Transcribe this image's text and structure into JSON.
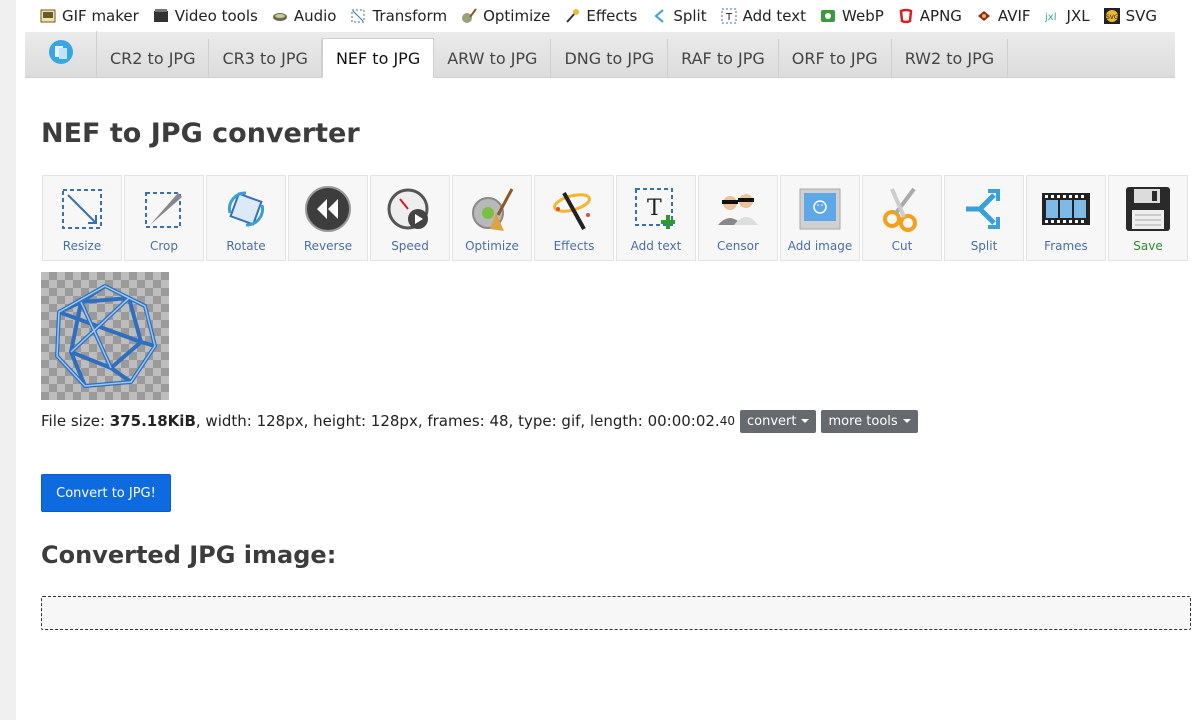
{
  "topnav": {
    "items": [
      {
        "label": "GIF maker",
        "icon": "gif-maker-icon"
      },
      {
        "label": "Video tools",
        "icon": "video-tools-icon"
      },
      {
        "label": "Audio",
        "icon": "audio-icon"
      },
      {
        "label": "Transform",
        "icon": "transform-icon"
      },
      {
        "label": "Optimize",
        "icon": "optimize-icon"
      },
      {
        "label": "Effects",
        "icon": "effects-icon"
      },
      {
        "label": "Split",
        "icon": "split-icon"
      },
      {
        "label": "Add text",
        "icon": "add-text-icon"
      },
      {
        "label": "WebP",
        "icon": "webp-icon"
      },
      {
        "label": "APNG",
        "icon": "apng-icon"
      },
      {
        "label": "AVIF",
        "icon": "avif-icon"
      },
      {
        "label": "JXL",
        "icon": "jxl-icon"
      },
      {
        "label": "SVG",
        "icon": "svg-icon"
      }
    ]
  },
  "tabs": {
    "home_icon": "home-icon",
    "items": [
      {
        "label": "CR2 to JPG",
        "active": false
      },
      {
        "label": "CR3 to JPG",
        "active": false
      },
      {
        "label": "NEF to JPG",
        "active": true
      },
      {
        "label": "ARW to JPG",
        "active": false
      },
      {
        "label": "DNG to JPG",
        "active": false
      },
      {
        "label": "RAF to JPG",
        "active": false
      },
      {
        "label": "ORF to JPG",
        "active": false
      },
      {
        "label": "RW2 to JPG",
        "active": false
      }
    ]
  },
  "page_title": "NEF to JPG converter",
  "tools": [
    {
      "label": "Resize",
      "icon": "resize-icon"
    },
    {
      "label": "Crop",
      "icon": "crop-icon"
    },
    {
      "label": "Rotate",
      "icon": "rotate-icon"
    },
    {
      "label": "Reverse",
      "icon": "reverse-icon"
    },
    {
      "label": "Speed",
      "icon": "speed-icon"
    },
    {
      "label": "Optimize",
      "icon": "optimize-icon"
    },
    {
      "label": "Effects",
      "icon": "effects-wand-icon"
    },
    {
      "label": "Add text",
      "icon": "add-text-icon"
    },
    {
      "label": "Censor",
      "icon": "censor-icon"
    },
    {
      "label": "Add image",
      "icon": "add-image-icon"
    },
    {
      "label": "Cut",
      "icon": "scissors-icon"
    },
    {
      "label": "Split",
      "icon": "split-icon"
    },
    {
      "label": "Frames",
      "icon": "film-frames-icon"
    },
    {
      "label": "Save",
      "icon": "floppy-save-icon"
    }
  ],
  "fileinfo": {
    "prefix": "File size: ",
    "size": "375.18KiB",
    "details": ", width: 128px, height: 128px, frames: 48, type: gif, length: 00:00:02.",
    "length_ms": "40",
    "convert_label": "convert",
    "more_tools_label": "more tools"
  },
  "convert_button": "Convert to JPG!",
  "result_heading": "Converted JPG image:",
  "colors": {
    "primary_button": "#0d6adf",
    "dropdown_button": "#666a6e",
    "tool_label": "#4a6fa5",
    "save_label": "#2f8a2f"
  }
}
